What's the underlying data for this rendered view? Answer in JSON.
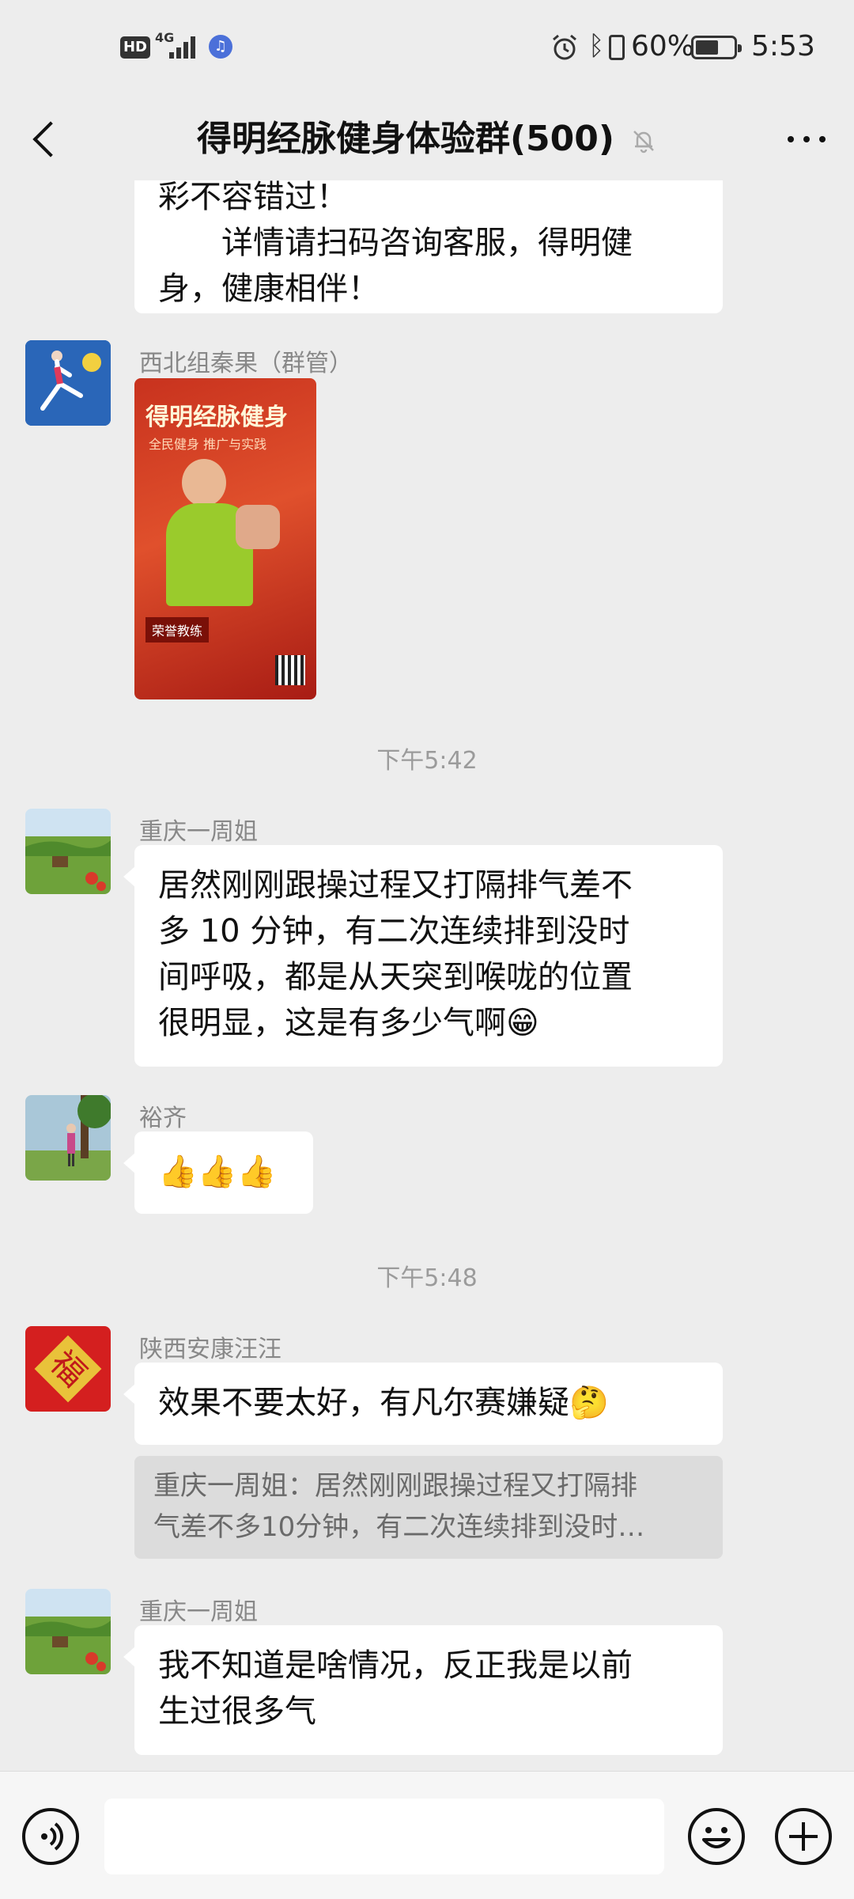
{
  "status_bar": {
    "hd": "HD",
    "network": "4G",
    "battery_percent": "60%",
    "battery_level": 0.6,
    "time": "5:53",
    "icons": [
      "music-icon",
      "alarm-icon",
      "bluetooth-icon",
      "vibrate-icon",
      "battery-icon"
    ]
  },
  "header": {
    "title": "得明经脉健身体验群(500)",
    "back_icon": "chevron-left-icon",
    "mute_icon": "bell-off-icon",
    "more_icon": "more-dots-icon"
  },
  "messages": [
    {
      "type": "text",
      "lines": [
        "彩不容错过！",
        "　　详情请扫码咨询客服，得明健",
        "身，健康相伴！"
      ]
    },
    {
      "type": "image",
      "sender": "西北组秦果（群管）",
      "poster_title": "得明经脉健身",
      "poster_subtitle": "全民健身 推广与实践",
      "poster_tag": "荣誉教练"
    },
    {
      "type": "time",
      "text": "下午5:42"
    },
    {
      "type": "text",
      "sender": "重庆一周姐",
      "lines": [
        "居然刚刚跟操过程又打隔排气差不",
        "多 10 分钟，有二次连续排到没时",
        "间呼吸，都是从天突到喉咙的位置",
        "很明显，这是有多少气啊😁"
      ]
    },
    {
      "type": "text",
      "sender": "裕齐",
      "lines": [
        "👍👍👍"
      ]
    },
    {
      "type": "time",
      "text": "下午5:48"
    },
    {
      "type": "text",
      "sender": "陕西安康汪汪",
      "avatar_char": "福",
      "lines": [
        "效果不要太好，有凡尔赛嫌疑🤔"
      ],
      "quote_lines": [
        "重庆一周姐：居然刚刚跟操过程又打隔排",
        "气差不多10分钟，有二次连续排到没时…"
      ]
    },
    {
      "type": "text",
      "sender": "重庆一周姐",
      "lines": [
        "我不知道是啥情况，反正我是以前",
        "生过很多气"
      ]
    }
  ],
  "input_bar": {
    "voice_icon": "voice-icon",
    "emoji_icon": "emoji-icon",
    "plus_icon": "plus-icon",
    "placeholder": ""
  },
  "colors": {
    "background": "#ededed",
    "bubble": "#ffffff",
    "quote": "#dcdcdc",
    "timestamp": "#9b9b9b"
  }
}
